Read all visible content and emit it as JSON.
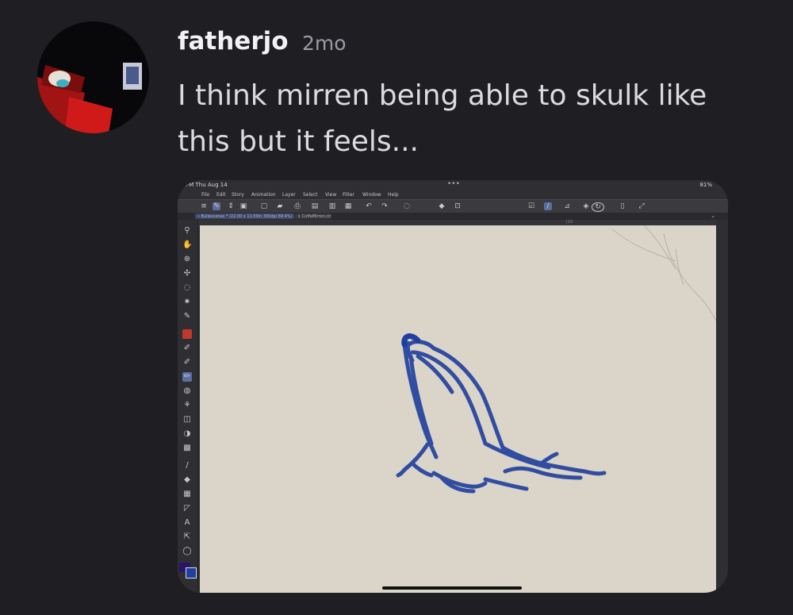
{
  "post": {
    "username": "fatherjo",
    "timestamp": "2mo",
    "message": "I think mirren being able to skulk like this but it feels..."
  },
  "attachment": {
    "status": {
      "time": "PM  Thu Aug 14",
      "battery": "81%"
    },
    "menu": [
      "File",
      "Edit",
      "Story",
      "Animation",
      "Layer",
      "Select",
      "View",
      "Filter",
      "Window",
      "Help"
    ],
    "tabs": {
      "active": "• Bullescenes * (22.00 x 11.00in 300dpi 89.4%)",
      "second": "× CoffeMirren.clr"
    },
    "ruler_mark": "|10",
    "brush_color": "#1e3f9e",
    "canvas_color": "#dbd4c8"
  },
  "icons": {
    "search": "⚲",
    "hand": "✋",
    "zoom": "⊕",
    "move": "✣",
    "lasso": "◌",
    "wand": "✷",
    "eyedropper": "✎",
    "pen": "✐",
    "brush": "✏",
    "eraser": "◫",
    "fill": "◆",
    "text": "A"
  }
}
